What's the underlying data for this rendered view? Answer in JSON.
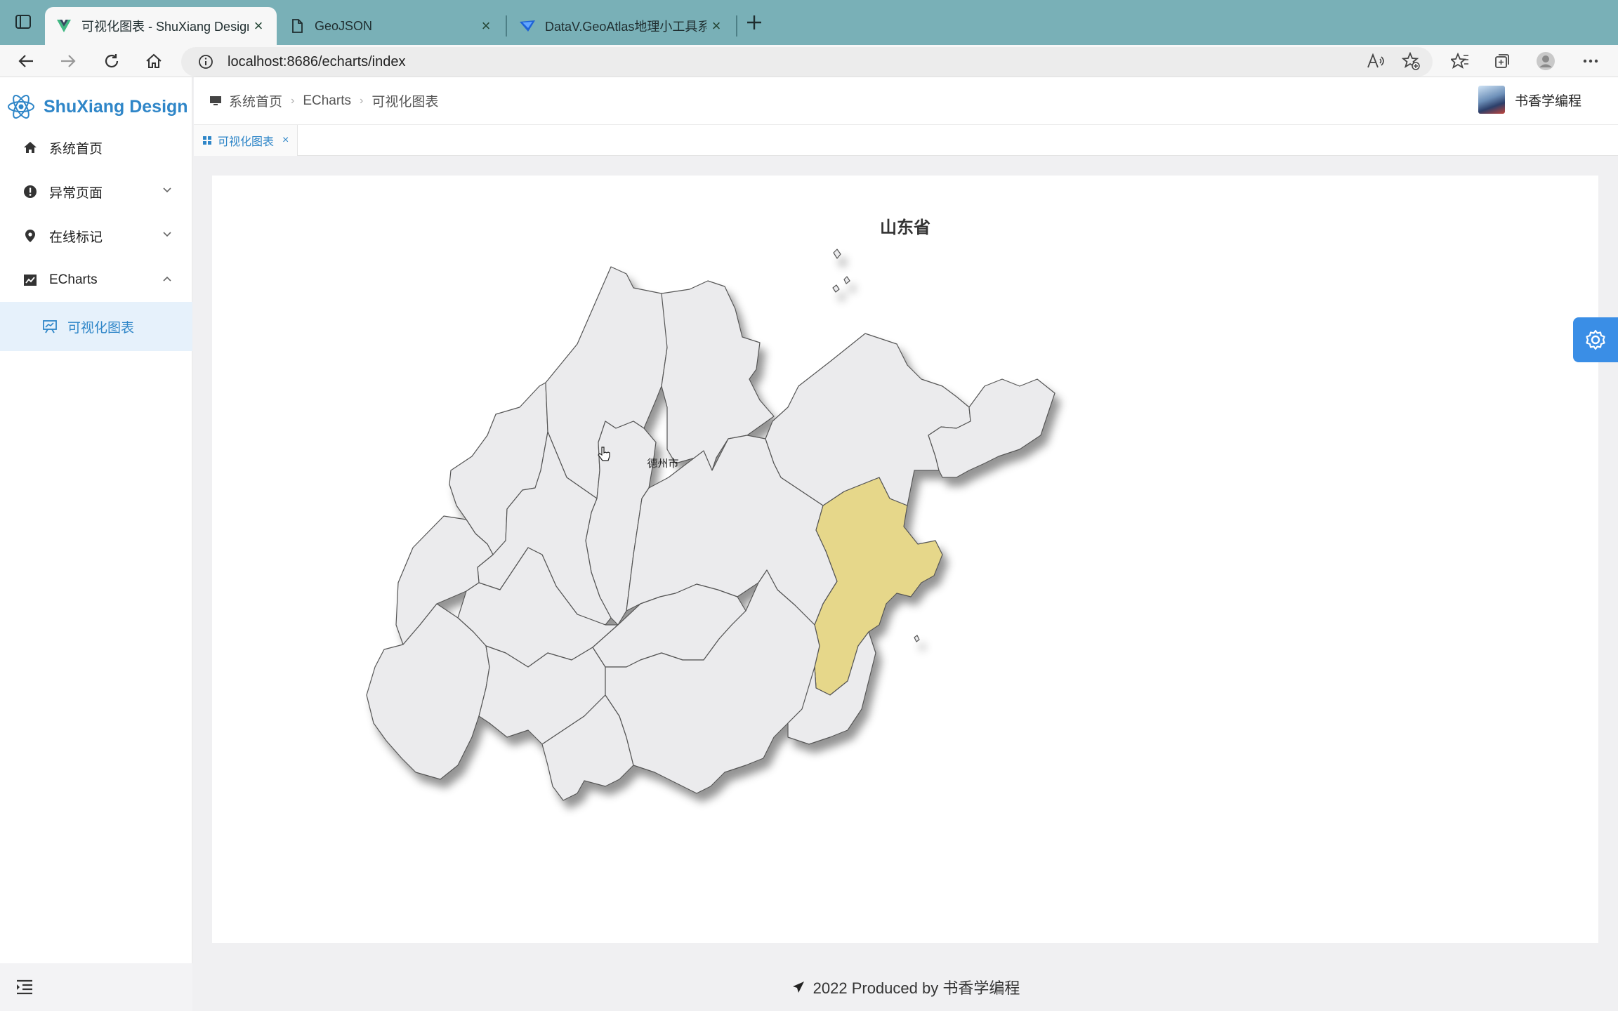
{
  "browser": {
    "tabs": [
      {
        "title": "可视化图表 - ShuXiang Design",
        "icon": "vue-logo-icon",
        "active": true
      },
      {
        "title": "GeoJSON",
        "icon": "document-icon",
        "active": false
      },
      {
        "title": "DataV.GeoAtlas地理小工具系列",
        "icon": "datav-logo-icon",
        "active": false
      }
    ],
    "url": "localhost:8686/echarts/index"
  },
  "app": {
    "logo_text": "ShuXiang Design",
    "menu": [
      {
        "label": "系统首页",
        "icon": "home-icon"
      },
      {
        "label": "异常页面",
        "icon": "warning-icon",
        "expandable": true
      },
      {
        "label": "在线标记",
        "icon": "location-pin-icon",
        "expandable": true
      },
      {
        "label": "ECharts",
        "icon": "chart-icon",
        "expanded": true
      },
      {
        "label": "可视化图表",
        "icon": "presentation-chart-icon",
        "selected": true
      }
    ],
    "breadcrumb": [
      "系统首页",
      "ECharts",
      "可视化图表"
    ],
    "user_name": "书香学编程",
    "open_tag": "可视化图表",
    "footer": "2022 Produced by 书香学编程"
  },
  "chart_data": {
    "type": "map",
    "title": "山东省",
    "region_label": "德州市",
    "highlight_color": "#e6d78a",
    "area_color": "#ebebed"
  }
}
